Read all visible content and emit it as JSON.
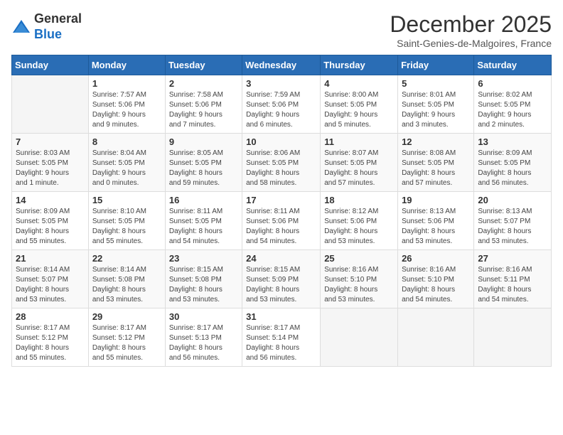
{
  "header": {
    "logo_line1": "General",
    "logo_line2": "Blue",
    "title": "December 2025",
    "subtitle": "Saint-Genies-de-Malgoires, France"
  },
  "weekdays": [
    "Sunday",
    "Monday",
    "Tuesday",
    "Wednesday",
    "Thursday",
    "Friday",
    "Saturday"
  ],
  "weeks": [
    [
      {
        "day": "",
        "info": ""
      },
      {
        "day": "1",
        "info": "Sunrise: 7:57 AM\nSunset: 5:06 PM\nDaylight: 9 hours\nand 9 minutes."
      },
      {
        "day": "2",
        "info": "Sunrise: 7:58 AM\nSunset: 5:06 PM\nDaylight: 9 hours\nand 7 minutes."
      },
      {
        "day": "3",
        "info": "Sunrise: 7:59 AM\nSunset: 5:06 PM\nDaylight: 9 hours\nand 6 minutes."
      },
      {
        "day": "4",
        "info": "Sunrise: 8:00 AM\nSunset: 5:05 PM\nDaylight: 9 hours\nand 5 minutes."
      },
      {
        "day": "5",
        "info": "Sunrise: 8:01 AM\nSunset: 5:05 PM\nDaylight: 9 hours\nand 3 minutes."
      },
      {
        "day": "6",
        "info": "Sunrise: 8:02 AM\nSunset: 5:05 PM\nDaylight: 9 hours\nand 2 minutes."
      }
    ],
    [
      {
        "day": "7",
        "info": "Sunrise: 8:03 AM\nSunset: 5:05 PM\nDaylight: 9 hours\nand 1 minute."
      },
      {
        "day": "8",
        "info": "Sunrise: 8:04 AM\nSunset: 5:05 PM\nDaylight: 9 hours\nand 0 minutes."
      },
      {
        "day": "9",
        "info": "Sunrise: 8:05 AM\nSunset: 5:05 PM\nDaylight: 8 hours\nand 59 minutes."
      },
      {
        "day": "10",
        "info": "Sunrise: 8:06 AM\nSunset: 5:05 PM\nDaylight: 8 hours\nand 58 minutes."
      },
      {
        "day": "11",
        "info": "Sunrise: 8:07 AM\nSunset: 5:05 PM\nDaylight: 8 hours\nand 57 minutes."
      },
      {
        "day": "12",
        "info": "Sunrise: 8:08 AM\nSunset: 5:05 PM\nDaylight: 8 hours\nand 57 minutes."
      },
      {
        "day": "13",
        "info": "Sunrise: 8:09 AM\nSunset: 5:05 PM\nDaylight: 8 hours\nand 56 minutes."
      }
    ],
    [
      {
        "day": "14",
        "info": "Sunrise: 8:09 AM\nSunset: 5:05 PM\nDaylight: 8 hours\nand 55 minutes."
      },
      {
        "day": "15",
        "info": "Sunrise: 8:10 AM\nSunset: 5:05 PM\nDaylight: 8 hours\nand 55 minutes."
      },
      {
        "day": "16",
        "info": "Sunrise: 8:11 AM\nSunset: 5:05 PM\nDaylight: 8 hours\nand 54 minutes."
      },
      {
        "day": "17",
        "info": "Sunrise: 8:11 AM\nSunset: 5:06 PM\nDaylight: 8 hours\nand 54 minutes."
      },
      {
        "day": "18",
        "info": "Sunrise: 8:12 AM\nSunset: 5:06 PM\nDaylight: 8 hours\nand 53 minutes."
      },
      {
        "day": "19",
        "info": "Sunrise: 8:13 AM\nSunset: 5:06 PM\nDaylight: 8 hours\nand 53 minutes."
      },
      {
        "day": "20",
        "info": "Sunrise: 8:13 AM\nSunset: 5:07 PM\nDaylight: 8 hours\nand 53 minutes."
      }
    ],
    [
      {
        "day": "21",
        "info": "Sunrise: 8:14 AM\nSunset: 5:07 PM\nDaylight: 8 hours\nand 53 minutes."
      },
      {
        "day": "22",
        "info": "Sunrise: 8:14 AM\nSunset: 5:08 PM\nDaylight: 8 hours\nand 53 minutes."
      },
      {
        "day": "23",
        "info": "Sunrise: 8:15 AM\nSunset: 5:08 PM\nDaylight: 8 hours\nand 53 minutes."
      },
      {
        "day": "24",
        "info": "Sunrise: 8:15 AM\nSunset: 5:09 PM\nDaylight: 8 hours\nand 53 minutes."
      },
      {
        "day": "25",
        "info": "Sunrise: 8:16 AM\nSunset: 5:10 PM\nDaylight: 8 hours\nand 53 minutes."
      },
      {
        "day": "26",
        "info": "Sunrise: 8:16 AM\nSunset: 5:10 PM\nDaylight: 8 hours\nand 54 minutes."
      },
      {
        "day": "27",
        "info": "Sunrise: 8:16 AM\nSunset: 5:11 PM\nDaylight: 8 hours\nand 54 minutes."
      }
    ],
    [
      {
        "day": "28",
        "info": "Sunrise: 8:17 AM\nSunset: 5:12 PM\nDaylight: 8 hours\nand 55 minutes."
      },
      {
        "day": "29",
        "info": "Sunrise: 8:17 AM\nSunset: 5:12 PM\nDaylight: 8 hours\nand 55 minutes."
      },
      {
        "day": "30",
        "info": "Sunrise: 8:17 AM\nSunset: 5:13 PM\nDaylight: 8 hours\nand 56 minutes."
      },
      {
        "day": "31",
        "info": "Sunrise: 8:17 AM\nSunset: 5:14 PM\nDaylight: 8 hours\nand 56 minutes."
      },
      {
        "day": "",
        "info": ""
      },
      {
        "day": "",
        "info": ""
      },
      {
        "day": "",
        "info": ""
      }
    ]
  ]
}
